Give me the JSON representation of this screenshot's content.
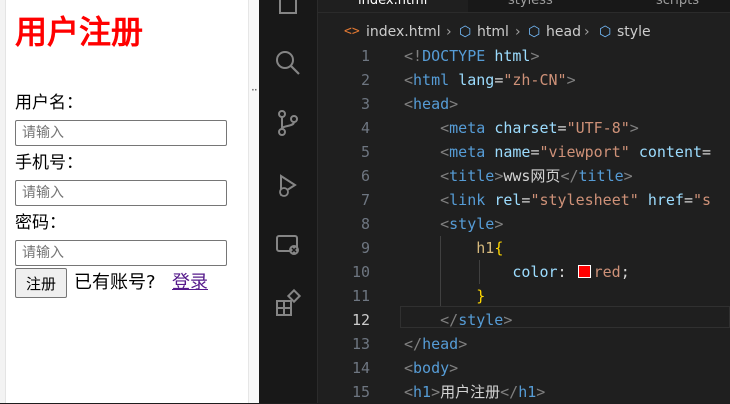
{
  "preview": {
    "heading": "用户注册",
    "username_label": "用户名：",
    "phone_label": "手机号：",
    "password_label": "密码：",
    "input_placeholder": "请输入",
    "register_button": "注册",
    "have_account_text": "已有账号?",
    "login_link": "登录"
  },
  "tabs": [
    {
      "label": "index.html",
      "active": true
    },
    {
      "label": "styless"
    },
    {
      "label": "scripts"
    }
  ],
  "breadcrumb": [
    "index.html",
    "html",
    "head",
    "style"
  ],
  "current_line": 12,
  "code_lines": [
    {
      "n": "1",
      "tokens": [
        [
          "t-gray",
          "<!"
        ],
        [
          "t-name",
          "DOCTYPE"
        ],
        [
          "t-text",
          " "
        ],
        [
          "t-attr",
          "html"
        ],
        [
          "t-gray",
          ">"
        ]
      ]
    },
    {
      "n": "2",
      "tokens": [
        [
          "t-gray",
          "<"
        ],
        [
          "t-name",
          "html"
        ],
        [
          "t-text",
          " "
        ],
        [
          "t-attr",
          "lang"
        ],
        [
          "t-text",
          "="
        ],
        [
          "t-str",
          "\"zh-CN\""
        ],
        [
          "t-gray",
          ">"
        ]
      ]
    },
    {
      "n": "3",
      "tokens": [
        [
          "t-gray",
          "<"
        ],
        [
          "t-name",
          "head"
        ],
        [
          "t-gray",
          ">"
        ]
      ]
    },
    {
      "n": "4",
      "tokens": [
        [
          "t-text",
          "    "
        ],
        [
          "t-gray",
          "<"
        ],
        [
          "t-name",
          "meta"
        ],
        [
          "t-text",
          " "
        ],
        [
          "t-attr",
          "charset"
        ],
        [
          "t-text",
          "="
        ],
        [
          "t-str",
          "\"UTF-8\""
        ],
        [
          "t-gray",
          ">"
        ]
      ]
    },
    {
      "n": "5",
      "tokens": [
        [
          "t-text",
          "    "
        ],
        [
          "t-gray",
          "<"
        ],
        [
          "t-name",
          "meta"
        ],
        [
          "t-text",
          " "
        ],
        [
          "t-attr",
          "name"
        ],
        [
          "t-text",
          "="
        ],
        [
          "t-str",
          "\"viewport\""
        ],
        [
          "t-text",
          " "
        ],
        [
          "t-attr",
          "content"
        ],
        [
          "t-text",
          "="
        ]
      ]
    },
    {
      "n": "6",
      "tokens": [
        [
          "t-text",
          "    "
        ],
        [
          "t-gray",
          "<"
        ],
        [
          "t-name",
          "title"
        ],
        [
          "t-gray",
          ">"
        ],
        [
          "t-text",
          "wws网页"
        ],
        [
          "t-gray",
          "</"
        ],
        [
          "t-name",
          "title"
        ],
        [
          "t-gray",
          ">"
        ]
      ]
    },
    {
      "n": "7",
      "tokens": [
        [
          "t-text",
          "    "
        ],
        [
          "t-gray",
          "<"
        ],
        [
          "t-name",
          "link"
        ],
        [
          "t-text",
          " "
        ],
        [
          "t-attr",
          "rel"
        ],
        [
          "t-text",
          "="
        ],
        [
          "t-str",
          "\"stylesheet\""
        ],
        [
          "t-text",
          " "
        ],
        [
          "t-attr",
          "href"
        ],
        [
          "t-text",
          "="
        ],
        [
          "t-str",
          "\"s"
        ]
      ]
    },
    {
      "n": "8",
      "tokens": [
        [
          "t-text",
          "    "
        ],
        [
          "t-gray",
          "<"
        ],
        [
          "t-name",
          "style"
        ],
        [
          "t-gray",
          ">"
        ]
      ]
    },
    {
      "n": "9",
      "tokens": [
        [
          "t-text",
          "        "
        ],
        [
          "t-sel",
          "h1"
        ],
        [
          "t-brace",
          "{"
        ]
      ]
    },
    {
      "n": "10",
      "tokens": [
        [
          "t-text",
          "            "
        ],
        [
          "t-prop",
          "color"
        ],
        [
          "t-text",
          ": "
        ],
        [
          "swatch",
          ""
        ],
        [
          "t-str",
          "red"
        ],
        [
          "t-text",
          ";"
        ]
      ]
    },
    {
      "n": "11",
      "tokens": [
        [
          "t-text",
          "        "
        ],
        [
          "t-brace",
          "}"
        ]
      ]
    },
    {
      "n": "12",
      "tokens": [
        [
          "t-text",
          "    "
        ],
        [
          "t-gray",
          "</"
        ],
        [
          "t-name",
          "style"
        ],
        [
          "t-gray",
          ">"
        ]
      ]
    },
    {
      "n": "13",
      "tokens": [
        [
          "t-gray",
          "</"
        ],
        [
          "t-name",
          "head"
        ],
        [
          "t-gray",
          ">"
        ]
      ]
    },
    {
      "n": "14",
      "tokens": [
        [
          "t-gray",
          "<"
        ],
        [
          "t-name",
          "body"
        ],
        [
          "t-gray",
          ">"
        ]
      ]
    },
    {
      "n": "15",
      "tokens": [
        [
          "t-gray",
          "<"
        ],
        [
          "t-name",
          "h1"
        ],
        [
          "t-gray",
          ">"
        ],
        [
          "t-text",
          "用户注册"
        ],
        [
          "t-gray",
          "</"
        ],
        [
          "t-name",
          "h1"
        ],
        [
          "t-gray",
          ">"
        ]
      ]
    }
  ],
  "activity_icons": [
    "explorer-icon",
    "search-icon",
    "source-control-icon",
    "run-debug-icon",
    "remote-explorer-icon",
    "extensions-icon"
  ],
  "colors": {
    "heading_red": "#ff0000",
    "link_purple": "#551a8b",
    "editor_bg": "#1f1f1f"
  }
}
